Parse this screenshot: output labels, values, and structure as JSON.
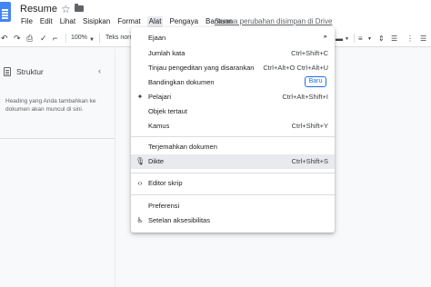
{
  "document": {
    "title": "Resume",
    "save_status": "Semua perubahan disimpan di Drive"
  },
  "menubar": [
    {
      "label": "File"
    },
    {
      "label": "Edit"
    },
    {
      "label": "Lihat"
    },
    {
      "label": "Sisipkan"
    },
    {
      "label": "Format"
    },
    {
      "label": "Alat"
    },
    {
      "label": "Pengaya"
    },
    {
      "label": "Bantuan"
    }
  ],
  "toolbar": {
    "zoom": "100%",
    "style": "Teks norm"
  },
  "outline": {
    "title": "Struktur",
    "hint": "Heading yang Anda tambahkan ke dokumen akan muncul di sini."
  },
  "tools_menu": {
    "items": [
      {
        "label": "Ejaan",
        "shortcut": "",
        "icon": "",
        "submenu": true
      },
      {
        "label": "Jumlah kata",
        "shortcut": "Ctrl+Shift+C",
        "icon": ""
      },
      {
        "label": "Tinjau pengeditan yang disarankan",
        "shortcut": "Ctrl+Alt+O Ctrl+Alt+U",
        "icon": ""
      },
      {
        "label": "Bandingkan dokumen",
        "badge": "Baru",
        "icon": ""
      },
      {
        "label": "Pelajari",
        "shortcut": "Ctrl+Alt+Shift+I",
        "icon": "explore-icon"
      },
      {
        "label": "Objek tertaut",
        "shortcut": "",
        "icon": ""
      },
      {
        "label": "Kamus",
        "shortcut": "Ctrl+Shift+Y",
        "icon": ""
      },
      {
        "label": "Terjemahkan dokumen",
        "shortcut": "",
        "icon": ""
      },
      {
        "label": "Dikte",
        "shortcut": "Ctrl+Shift+S",
        "icon": "mic-icon"
      },
      {
        "label": "Editor skrip",
        "shortcut": "",
        "icon": "code-icon"
      },
      {
        "label": "Preferensi",
        "shortcut": "",
        "icon": ""
      },
      {
        "label": "Setelan aksesibilitas",
        "shortcut": "",
        "icon": "accessibility-icon"
      }
    ]
  },
  "colors": {
    "accent": "#1a73e8",
    "doc_blue": "#4285f4",
    "hover": "#e8eaed"
  }
}
